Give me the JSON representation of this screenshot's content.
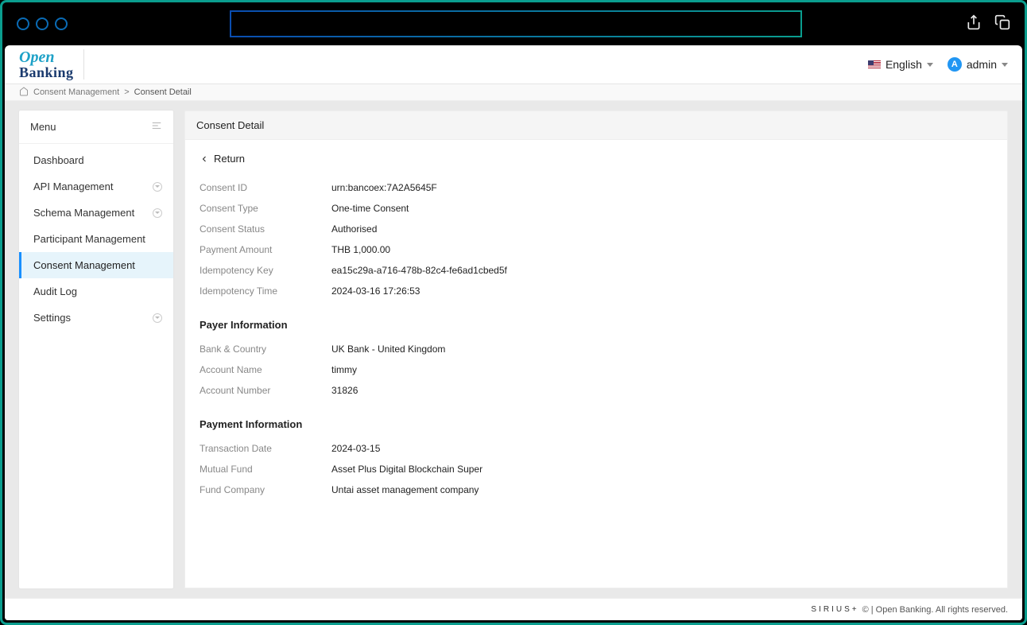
{
  "header": {
    "logo_top": "Open",
    "logo_bottom": "Banking",
    "language": "English",
    "user": "admin",
    "avatar_letter": "A"
  },
  "breadcrumb": {
    "parent": "Consent Management",
    "current": "Consent Detail"
  },
  "sidebar": {
    "title": "Menu",
    "items": [
      {
        "label": "Dashboard",
        "expandable": false,
        "active": false
      },
      {
        "label": "API Management",
        "expandable": true,
        "active": false
      },
      {
        "label": "Schema Management",
        "expandable": true,
        "active": false
      },
      {
        "label": "Participant Management",
        "expandable": false,
        "active": false
      },
      {
        "label": "Consent Management",
        "expandable": false,
        "active": true
      },
      {
        "label": "Audit Log",
        "expandable": false,
        "active": false
      },
      {
        "label": "Settings",
        "expandable": true,
        "active": false
      }
    ]
  },
  "content": {
    "title": "Consent Detail",
    "return_label": "Return",
    "details": [
      {
        "label": "Consent ID",
        "value": "urn:bancoex:7A2A5645F"
      },
      {
        "label": "Consent Type",
        "value": "One-time Consent"
      },
      {
        "label": "Consent Status",
        "value": "Authorised"
      },
      {
        "label": "Payment Amount",
        "value": "THB 1,000.00"
      },
      {
        "label": "Idempotency Key",
        "value": "ea15c29a-a716-478b-82c4-fe6ad1cbed5f"
      },
      {
        "label": "Idempotency Time",
        "value": "2024-03-16 17:26:53"
      }
    ],
    "payer_section_title": "Payer Information",
    "payer": [
      {
        "label": "Bank & Country",
        "value": "UK Bank - United Kingdom"
      },
      {
        "label": "Account Name",
        "value": "timmy"
      },
      {
        "label": "Account Number",
        "value": "31826"
      }
    ],
    "payment_section_title": "Payment Information",
    "payment": [
      {
        "label": "Transaction Date",
        "value": "2024-03-15"
      },
      {
        "label": "Mutual Fund",
        "value": "Asset Plus Digital Blockchain Super"
      },
      {
        "label": "Fund Company",
        "value": "Untai asset management company"
      }
    ]
  },
  "footer": {
    "brand": "SIRIUS+",
    "text": "© | Open Banking. All rights reserved."
  }
}
